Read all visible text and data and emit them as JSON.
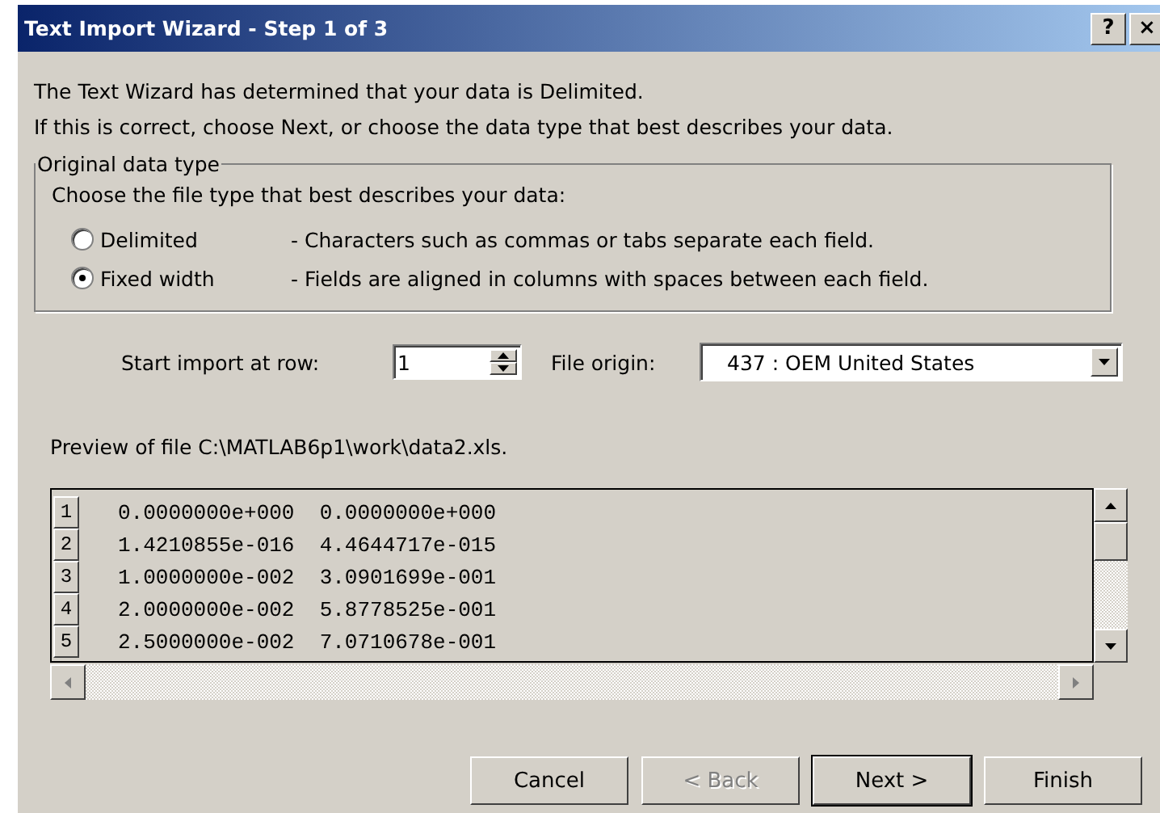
{
  "window": {
    "title": "Text Import Wizard - Step 1 of 3",
    "title_buttons": [
      "?",
      "×"
    ]
  },
  "intro": [
    "The Text Wizard has determined that your data is Delimited.",
    "If this is correct, choose Next, or choose the data type that best describes your data."
  ],
  "group": {
    "legend": "Original data type",
    "prompt": "Choose the file type that best describes your data:",
    "options": [
      {
        "label": "Delimited",
        "description": "- Characters such as commas or tabs separate each field.",
        "selected": false
      },
      {
        "label": "Fixed width",
        "description": "- Fields are aligned in columns with spaces between each field.",
        "selected": true
      }
    ]
  },
  "start_row": {
    "label": "Start import at row:",
    "value": "1"
  },
  "file_origin": {
    "label": "File origin:",
    "value": "437 : OEM United States"
  },
  "preview": {
    "label": "Preview of file C:\\MATLAB6p1\\work\\data2.xls.",
    "rows": [
      {
        "number": "1",
        "text": "0.0000000e+000  0.0000000e+000"
      },
      {
        "number": "2",
        "text": "1.4210855e-016  4.4644717e-015"
      },
      {
        "number": "3",
        "text": "1.0000000e-002  3.0901699e-001"
      },
      {
        "number": "4",
        "text": "2.0000000e-002  5.8778525e-001"
      },
      {
        "number": "5",
        "text": "2.5000000e-002  7.0710678e-001"
      }
    ]
  },
  "buttons": [
    {
      "label": "Cancel",
      "disabled": false,
      "default": false
    },
    {
      "label": "< Back",
      "disabled": true,
      "default": false
    },
    {
      "label": "Next >",
      "disabled": false,
      "default": true
    },
    {
      "label": "Finish",
      "disabled": false,
      "default": false
    }
  ]
}
